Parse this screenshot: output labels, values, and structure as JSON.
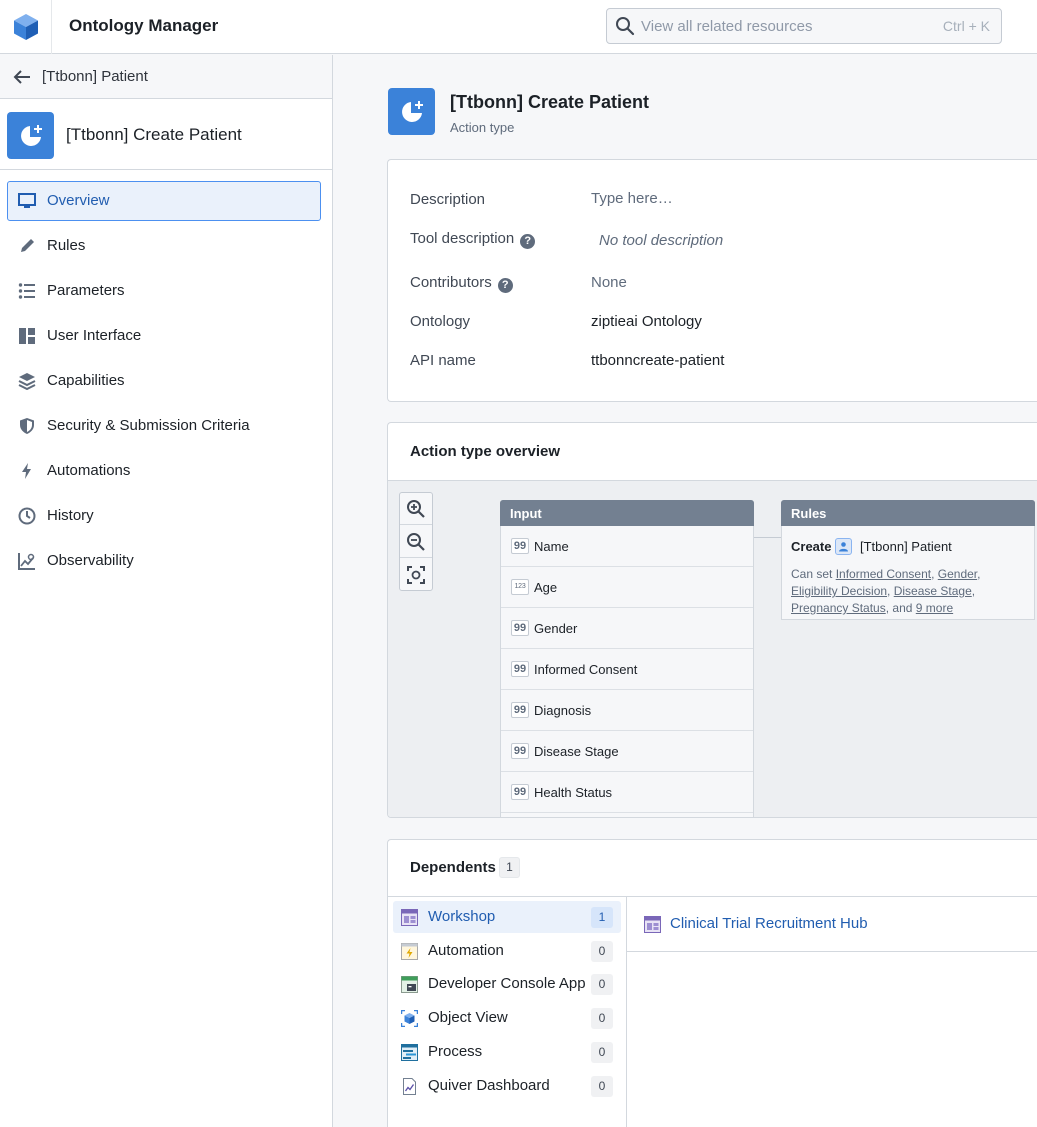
{
  "app": {
    "title": "Ontology Manager"
  },
  "search": {
    "placeholder": "View all related resources",
    "shortcut": "Ctrl + K"
  },
  "sidebar": {
    "back_label": "[Ttbonn] Patient",
    "entity_title": "[Ttbonn] Create Patient",
    "nav": [
      {
        "label": "Overview",
        "icon": "monitor-icon",
        "active": true
      },
      {
        "label": "Rules",
        "icon": "pencil-icon"
      },
      {
        "label": "Parameters",
        "icon": "list-icon"
      },
      {
        "label": "User Interface",
        "icon": "layout-icon"
      },
      {
        "label": "Capabilities",
        "icon": "layers-icon"
      },
      {
        "label": "Security & Submission Criteria",
        "icon": "shield-icon"
      },
      {
        "label": "Automations",
        "icon": "lightning-icon"
      },
      {
        "label": "History",
        "icon": "clock-icon"
      },
      {
        "label": "Observability",
        "icon": "chart-icon"
      }
    ]
  },
  "header": {
    "title": "[Ttbonn] Create Patient",
    "subtitle": "Action type"
  },
  "details": {
    "description_label": "Description",
    "description_value": "Type here…",
    "tool_description_label": "Tool description",
    "tool_description_value": "No tool description",
    "contributors_label": "Contributors",
    "contributors_value": "None",
    "ontology_label": "Ontology",
    "ontology_value": "ziptieai Ontology",
    "api_name_label": "API name",
    "api_name_value": "ttbonncreate-patient"
  },
  "overview": {
    "title": "Action type overview",
    "inputs_header": "Input",
    "inputs": [
      {
        "name": "Name",
        "type": "99"
      },
      {
        "name": "Age",
        "type": "123"
      },
      {
        "name": "Gender",
        "type": "99"
      },
      {
        "name": "Informed Consent",
        "type": "99"
      },
      {
        "name": "Diagnosis",
        "type": "99"
      },
      {
        "name": "Disease Stage",
        "type": "99"
      },
      {
        "name": "Health Status",
        "type": "99"
      }
    ],
    "rules_header": "Rules",
    "rule": {
      "verb": "Create",
      "object": "[Ttbonn] Patient",
      "prefix": "Can set",
      "links": [
        "Informed Consent",
        "Gender",
        "Eligibility Decision",
        "Disease Stage",
        "Pregnancy Status"
      ],
      "and_text": "and",
      "more": "9 more"
    }
  },
  "dependents": {
    "title": "Dependents",
    "count": "1",
    "items": [
      {
        "label": "Workshop",
        "count": "1",
        "icon": "workshop-icon",
        "active": true
      },
      {
        "label": "Automation",
        "count": "0",
        "icon": "automation-icon"
      },
      {
        "label": "Developer Console App",
        "count": "0",
        "icon": "developer-console-icon"
      },
      {
        "label": "Object View",
        "count": "0",
        "icon": "object-view-icon"
      },
      {
        "label": "Process",
        "count": "0",
        "icon": "process-icon"
      },
      {
        "label": "Quiver Dashboard",
        "count": "0",
        "icon": "quiver-icon"
      }
    ],
    "result": {
      "label": "Clinical Trial Recruitment Hub",
      "icon": "workshop-icon"
    }
  },
  "colors": {
    "accent": "#215db0",
    "brand": "#3b82d9",
    "node_header": "#738091"
  }
}
